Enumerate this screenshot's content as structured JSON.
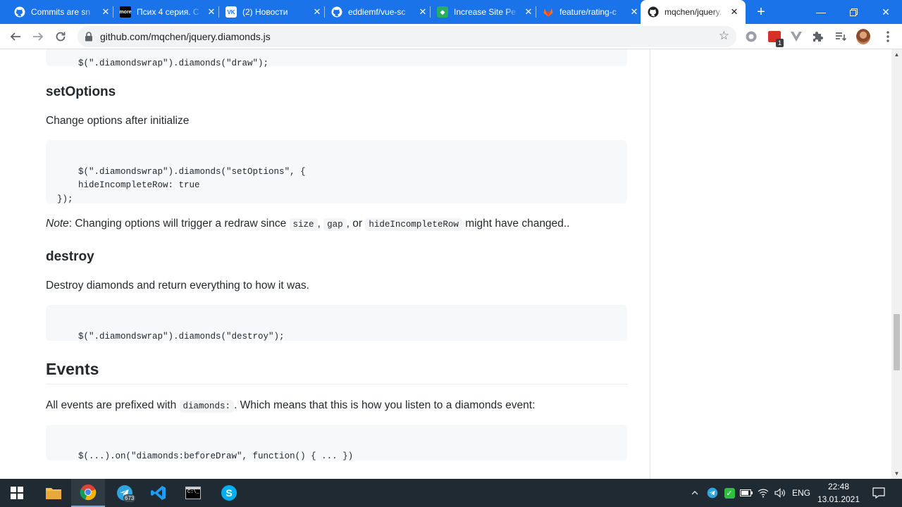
{
  "browser": {
    "tabs": [
      {
        "title": "Commits are sn",
        "icon": "github-icon"
      },
      {
        "title": "Псих 4 серия. С",
        "icon": "more-tv-icon"
      },
      {
        "title": "(2) Новости",
        "icon": "vk-icon"
      },
      {
        "title": "eddiemf/vue-sc",
        "icon": "github-icon"
      },
      {
        "title": "Increase Site Pe",
        "icon": "site-icon"
      },
      {
        "title": "feature/rating-c",
        "icon": "gitlab-icon"
      },
      {
        "title": "mqchen/jquery.",
        "icon": "github-icon"
      }
    ],
    "url": "github.com/mqchen/jquery.diamonds.js",
    "extension_badge": "1"
  },
  "content": {
    "top_code": "$(\".diamondswrap\").diamonds(\"draw\");",
    "setoptions_heading": "setOptions",
    "setoptions_desc": "Change options after initialize",
    "setoptions_code": "$(\".diamondswrap\").diamonds(\"setOptions\", {\n    hideIncompleteRow: true\n});",
    "note_label": "Note",
    "note_text_1": ": Changing options will trigger a redraw since ",
    "note_code_1": "size",
    "note_sep_1": ", ",
    "note_code_2": "gap",
    "note_sep_2": ", or ",
    "note_code_3": "hideIncompleteRow",
    "note_text_2": " might have changed..",
    "destroy_heading": "destroy",
    "destroy_desc": "Destroy diamonds and return everything to how it was.",
    "destroy_code": "$(\".diamondswrap\").diamonds(\"destroy\");",
    "events_heading": "Events",
    "events_text_1": "All events are prefixed with ",
    "events_code": "diamonds:",
    "events_text_2": ". Which means that this is how you listen to a diamonds event:",
    "events_example": "$(...).on(\"diamonds:beforeDraw\", function() { ... })"
  },
  "taskbar": {
    "telegram_badge": "673",
    "language": "ENG",
    "time": "22:48",
    "date": "13.01.2021"
  }
}
